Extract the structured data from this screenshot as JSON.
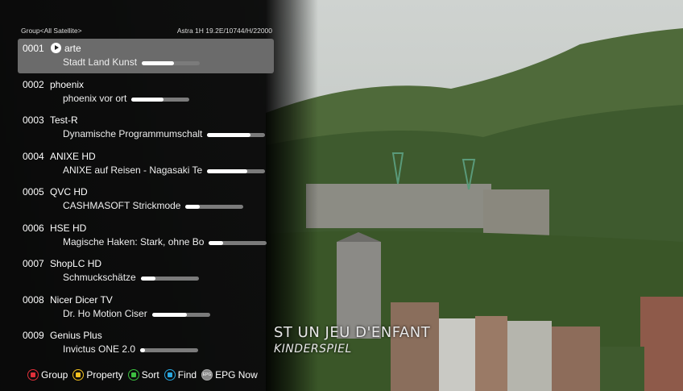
{
  "header": {
    "group": "Group<All Satellite>",
    "satellite": "Astra 1H 19.2E/10744/H/22000"
  },
  "channels": [
    {
      "number": "0001",
      "name": "arte",
      "program": "Stadt Land Kunst",
      "progress": 0.55,
      "selected": true,
      "playing": true
    },
    {
      "number": "0002",
      "name": "phoenix",
      "program": "phoenix vor ort",
      "progress": 0.55
    },
    {
      "number": "0003",
      "name": "Test-R",
      "program": "Dynamische Programmumschalt",
      "progress": 0.75
    },
    {
      "number": "0004",
      "name": "ANIXE HD",
      "program": "ANIXE auf Reisen - Nagasaki Te",
      "progress": 0.7
    },
    {
      "number": "0005",
      "name": "QVC HD",
      "program": "CASHMASOFT Strickmode",
      "progress": 0.25
    },
    {
      "number": "0006",
      "name": "HSE HD",
      "program": "Magische Haken: Stark, ohne Bo",
      "progress": 0.25
    },
    {
      "number": "0007",
      "name": "ShopLC HD",
      "program": "Schmuckschätze",
      "progress": 0.25
    },
    {
      "number": "0008",
      "name": "Nicer Dicer TV",
      "program": "Dr. Ho Motion Ciser",
      "progress": 0.6
    },
    {
      "number": "0009",
      "name": "Genius Plus",
      "program": "Invictus ONE 2.0",
      "progress": 0.05
    }
  ],
  "footer": {
    "group": "Group",
    "property": "Property",
    "sort": "Sort",
    "find": "Find",
    "epg_key": "EPG",
    "epg_now": "EPG Now"
  },
  "video_subtitle": {
    "line1": "ST UN JEU D'ENFANT",
    "line2": "KINDERSPIEL"
  },
  "colors": {
    "red": "#e0303a",
    "yellow": "#f0c020",
    "green": "#3cc040",
    "blue": "#2aa8e0",
    "selected_row": "#6b6b6b"
  }
}
